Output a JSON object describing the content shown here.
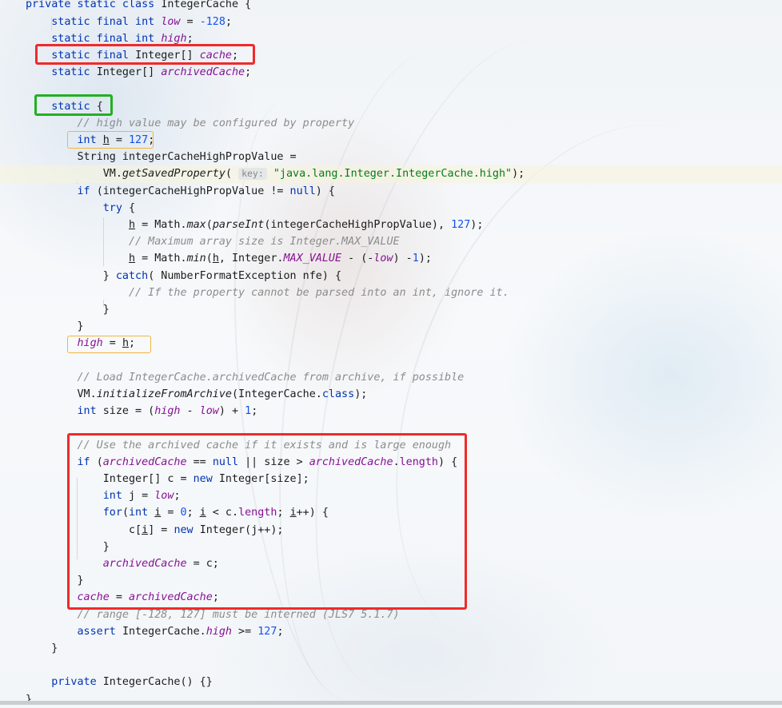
{
  "editor": {
    "lines": [
      [
        {
          "t": "private static class ",
          "c": "kw"
        },
        {
          "t": "IntegerCache {"
        }
      ],
      [
        {
          "t": "    "
        },
        {
          "t": "static final int ",
          "c": "kw"
        },
        {
          "t": "low",
          "c": "fld"
        },
        {
          "t": " = "
        },
        {
          "t": "-128",
          "c": "num"
        },
        {
          "t": ";"
        }
      ],
      [
        {
          "t": "    "
        },
        {
          "t": "static final int ",
          "c": "kw"
        },
        {
          "t": "high",
          "c": "fld"
        },
        {
          "t": ";"
        }
      ],
      [
        {
          "t": "    "
        },
        {
          "t": "static final ",
          "c": "kw"
        },
        {
          "t": "Integer[] "
        },
        {
          "t": "cache",
          "c": "fld"
        },
        {
          "t": ";"
        }
      ],
      [
        {
          "t": "    "
        },
        {
          "t": "static ",
          "c": "kw"
        },
        {
          "t": "Integer[] "
        },
        {
          "t": "archivedCache",
          "c": "fld"
        },
        {
          "t": ";"
        }
      ],
      [],
      [
        {
          "t": "    "
        },
        {
          "t": "static ",
          "c": "kw"
        },
        {
          "t": "{"
        }
      ],
      [
        {
          "t": "        "
        },
        {
          "t": "// high value may be configured by property",
          "c": "cmt"
        }
      ],
      [
        {
          "t": "        "
        },
        {
          "t": "int ",
          "c": "kw"
        },
        {
          "t": "h",
          "c": "ul"
        },
        {
          "t": " = "
        },
        {
          "t": "127",
          "c": "num"
        },
        {
          "t": ";"
        }
      ],
      [
        {
          "t": "        "
        },
        {
          "t": "String integerCacheHighPropValue ="
        }
      ],
      [
        {
          "t": "            "
        },
        {
          "t": "VM."
        },
        {
          "t": "getSavedProperty",
          "c": "smeth"
        },
        {
          "t": "( "
        },
        {
          "t": "key:",
          "c": "hint"
        },
        {
          "t": " "
        },
        {
          "t": "\"java.lang.Integer.IntegerCache.high\"",
          "c": "str"
        },
        {
          "t": ");"
        }
      ],
      [
        {
          "t": "        "
        },
        {
          "t": "if ",
          "c": "kw"
        },
        {
          "t": "(integerCacheHighPropValue != "
        },
        {
          "t": "null",
          "c": "kw"
        },
        {
          "t": ") {"
        }
      ],
      [
        {
          "t": "            "
        },
        {
          "t": "try ",
          "c": "kw"
        },
        {
          "t": "{"
        }
      ],
      [
        {
          "t": "                "
        },
        {
          "t": "h",
          "c": "ul"
        },
        {
          "t": " = Math."
        },
        {
          "t": "max",
          "c": "smeth"
        },
        {
          "t": "("
        },
        {
          "t": "parseInt",
          "c": "smeth"
        },
        {
          "t": "(integerCacheHighPropValue), "
        },
        {
          "t": "127",
          "c": "num"
        },
        {
          "t": ");"
        }
      ],
      [
        {
          "t": "                "
        },
        {
          "t": "// Maximum array size is Integer.MAX_VALUE",
          "c": "cmt"
        }
      ],
      [
        {
          "t": "                "
        },
        {
          "t": "h",
          "c": "ul"
        },
        {
          "t": " = Math."
        },
        {
          "t": "min",
          "c": "smeth"
        },
        {
          "t": "("
        },
        {
          "t": "h",
          "c": "ul"
        },
        {
          "t": ", Integer."
        },
        {
          "t": "MAX_VALUE",
          "c": "fld"
        },
        {
          "t": " - (-"
        },
        {
          "t": "low",
          "c": "fld"
        },
        {
          "t": ") -"
        },
        {
          "t": "1",
          "c": "num"
        },
        {
          "t": ");"
        }
      ],
      [
        {
          "t": "            "
        },
        {
          "t": "} "
        },
        {
          "t": "catch",
          "c": "kw"
        },
        {
          "t": "( NumberFormatException nfe) {"
        }
      ],
      [
        {
          "t": "                "
        },
        {
          "t": "// If the property cannot be parsed into an int, ignore it.",
          "c": "cmt"
        }
      ],
      [
        {
          "t": "            "
        },
        {
          "t": "}"
        }
      ],
      [
        {
          "t": "        "
        },
        {
          "t": "}"
        }
      ],
      [
        {
          "t": "        "
        },
        {
          "t": "high",
          "c": "fld"
        },
        {
          "t": " = "
        },
        {
          "t": "h",
          "c": "ul"
        },
        {
          "t": ";"
        }
      ],
      [],
      [
        {
          "t": "        "
        },
        {
          "t": "// Load IntegerCache.archivedCache from archive, if possible",
          "c": "cmt"
        }
      ],
      [
        {
          "t": "        "
        },
        {
          "t": "VM."
        },
        {
          "t": "initializeFromArchive",
          "c": "smeth"
        },
        {
          "t": "(IntegerCache."
        },
        {
          "t": "class",
          "c": "kw"
        },
        {
          "t": ");"
        }
      ],
      [
        {
          "t": "        "
        },
        {
          "t": "int ",
          "c": "kw"
        },
        {
          "t": "size = ("
        },
        {
          "t": "high",
          "c": "fld"
        },
        {
          "t": " - "
        },
        {
          "t": "low",
          "c": "fld"
        },
        {
          "t": ") + "
        },
        {
          "t": "1",
          "c": "num"
        },
        {
          "t": ";"
        }
      ],
      [],
      [
        {
          "t": "        "
        },
        {
          "t": "// Use the archived cache if it exists and is large enough",
          "c": "cmt"
        }
      ],
      [
        {
          "t": "        "
        },
        {
          "t": "if ",
          "c": "kw"
        },
        {
          "t": "("
        },
        {
          "t": "archivedCache",
          "c": "fld"
        },
        {
          "t": " == "
        },
        {
          "t": "null",
          "c": "kw"
        },
        {
          "t": " || size > "
        },
        {
          "t": "archivedCache",
          "c": "fld"
        },
        {
          "t": "."
        },
        {
          "t": "length",
          "c": "fld-n"
        },
        {
          "t": ") {"
        }
      ],
      [
        {
          "t": "            "
        },
        {
          "t": "Integer[] c = "
        },
        {
          "t": "new ",
          "c": "kw"
        },
        {
          "t": "Integer[size];"
        }
      ],
      [
        {
          "t": "            "
        },
        {
          "t": "int ",
          "c": "kw"
        },
        {
          "t": "j = "
        },
        {
          "t": "low",
          "c": "fld"
        },
        {
          "t": ";"
        }
      ],
      [
        {
          "t": "            "
        },
        {
          "t": "for",
          "c": "kw"
        },
        {
          "t": "("
        },
        {
          "t": "int ",
          "c": "kw"
        },
        {
          "t": "i",
          "c": "ul"
        },
        {
          "t": " = "
        },
        {
          "t": "0",
          "c": "num"
        },
        {
          "t": "; "
        },
        {
          "t": "i",
          "c": "ul"
        },
        {
          "t": " < c."
        },
        {
          "t": "length",
          "c": "fld-n"
        },
        {
          "t": "; "
        },
        {
          "t": "i",
          "c": "ul"
        },
        {
          "t": "++) {"
        }
      ],
      [
        {
          "t": "                "
        },
        {
          "t": "c["
        },
        {
          "t": "i",
          "c": "ul"
        },
        {
          "t": "] = "
        },
        {
          "t": "new ",
          "c": "kw"
        },
        {
          "t": "Integer(j++);"
        }
      ],
      [
        {
          "t": "            "
        },
        {
          "t": "}"
        }
      ],
      [
        {
          "t": "            "
        },
        {
          "t": "archivedCache",
          "c": "fld"
        },
        {
          "t": " = c;"
        }
      ],
      [
        {
          "t": "        "
        },
        {
          "t": "}"
        }
      ],
      [
        {
          "t": "        "
        },
        {
          "t": "cache",
          "c": "fld"
        },
        {
          "t": " = "
        },
        {
          "t": "archivedCache",
          "c": "fld"
        },
        {
          "t": ";"
        }
      ],
      [
        {
          "t": "        "
        },
        {
          "t": "// range [-128, 127] must be interned (JLS7 5.1.7)",
          "c": "cmt"
        }
      ],
      [
        {
          "t": "        "
        },
        {
          "t": "assert ",
          "c": "kw"
        },
        {
          "t": "IntegerCache."
        },
        {
          "t": "high",
          "c": "fld"
        },
        {
          "t": " >= "
        },
        {
          "t": "127",
          "c": "num"
        },
        {
          "t": ";"
        }
      ],
      [
        {
          "t": "    "
        },
        {
          "t": "}"
        }
      ],
      [],
      [
        {
          "t": "    "
        },
        {
          "t": "private ",
          "c": "kw"
        },
        {
          "t": "IntegerCache() {}"
        }
      ],
      [
        {
          "t": "}"
        }
      ]
    ]
  }
}
